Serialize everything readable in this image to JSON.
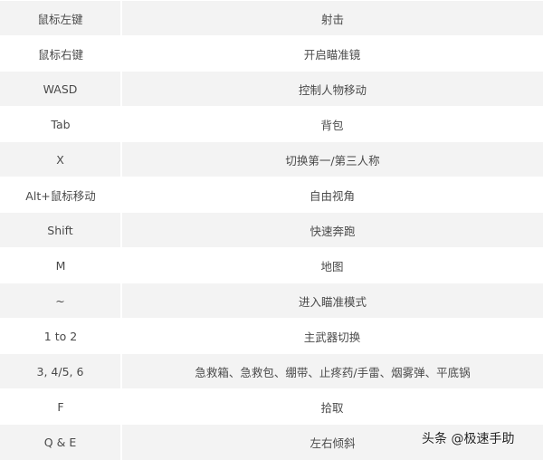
{
  "rows": [
    {
      "key": "鼠标左键",
      "action": "射击"
    },
    {
      "key": "鼠标右键",
      "action": "开启瞄准镜"
    },
    {
      "key": "WASD",
      "action": "控制人物移动"
    },
    {
      "key": "Tab",
      "action": "背包"
    },
    {
      "key": "X",
      "action": "切换第一/第三人称"
    },
    {
      "key": "Alt+鼠标移动",
      "action": "自由视角"
    },
    {
      "key": "Shift",
      "action": "快速奔跑"
    },
    {
      "key": "M",
      "action": "地图"
    },
    {
      "key": "~",
      "action": "进入瞄准模式"
    },
    {
      "key": "1 to 2",
      "action": "主武器切换"
    },
    {
      "key": "3, 4/5, 6",
      "action": "急救箱、急救包、绷带、止疼药/手雷、烟雾弹、平底锅"
    },
    {
      "key": "F",
      "action": "拾取"
    },
    {
      "key": "Q & E",
      "action": "左右倾斜"
    }
  ],
  "watermark": "头条 @极速手助"
}
